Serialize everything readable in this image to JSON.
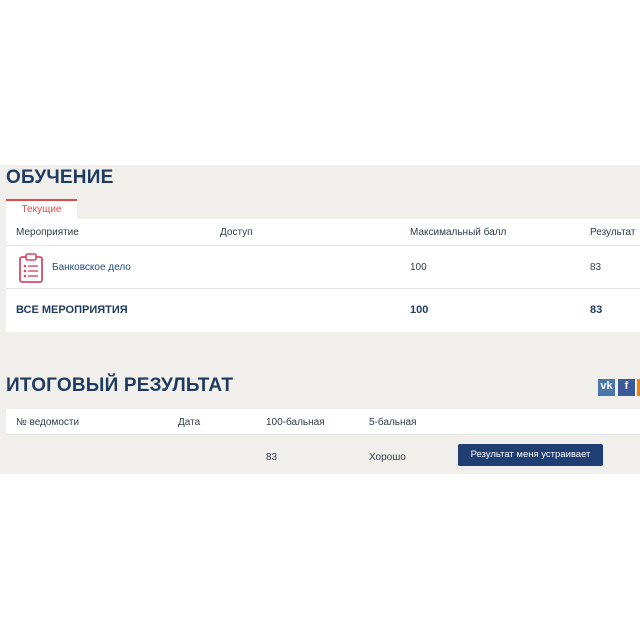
{
  "training": {
    "title": "ОБУЧЕНИЕ",
    "tab_current": "Текущие",
    "headers": {
      "event": "Мероприятие",
      "access": "Доступ",
      "max_score": "Максимальный балл",
      "result": "Результат"
    },
    "rows": [
      {
        "event": "Банковское дело",
        "access": "",
        "max_score": "100",
        "result": "83",
        "icon": "checklist-document-icon"
      }
    ],
    "total": {
      "label": "ВСЕ МЕРОПРИЯТИЯ",
      "max_score": "100",
      "result": "83"
    }
  },
  "final": {
    "title": "ИТОГОВЫЙ РЕЗУЛЬТАТ",
    "headers": {
      "statement_no": "№ ведомости",
      "date": "Дата",
      "score_100": "100-бальная",
      "score_5": "5-бальная"
    },
    "row": {
      "statement_no": "",
      "date": "",
      "score_100": "83",
      "score_5": "Хорошо"
    },
    "accept_button": "Результат меня устраивает"
  },
  "share": {
    "vk_label": "vk",
    "fb_label": "f",
    "colors": {
      "vk": "#4a76a8",
      "fb": "#3b5998",
      "ok": "#ee8208"
    }
  },
  "colors": {
    "accent_red": "#e34b4b",
    "title_blue": "#1f3a5f",
    "button_blue": "#1f3f73",
    "panel_bg": "#f1efeb"
  }
}
